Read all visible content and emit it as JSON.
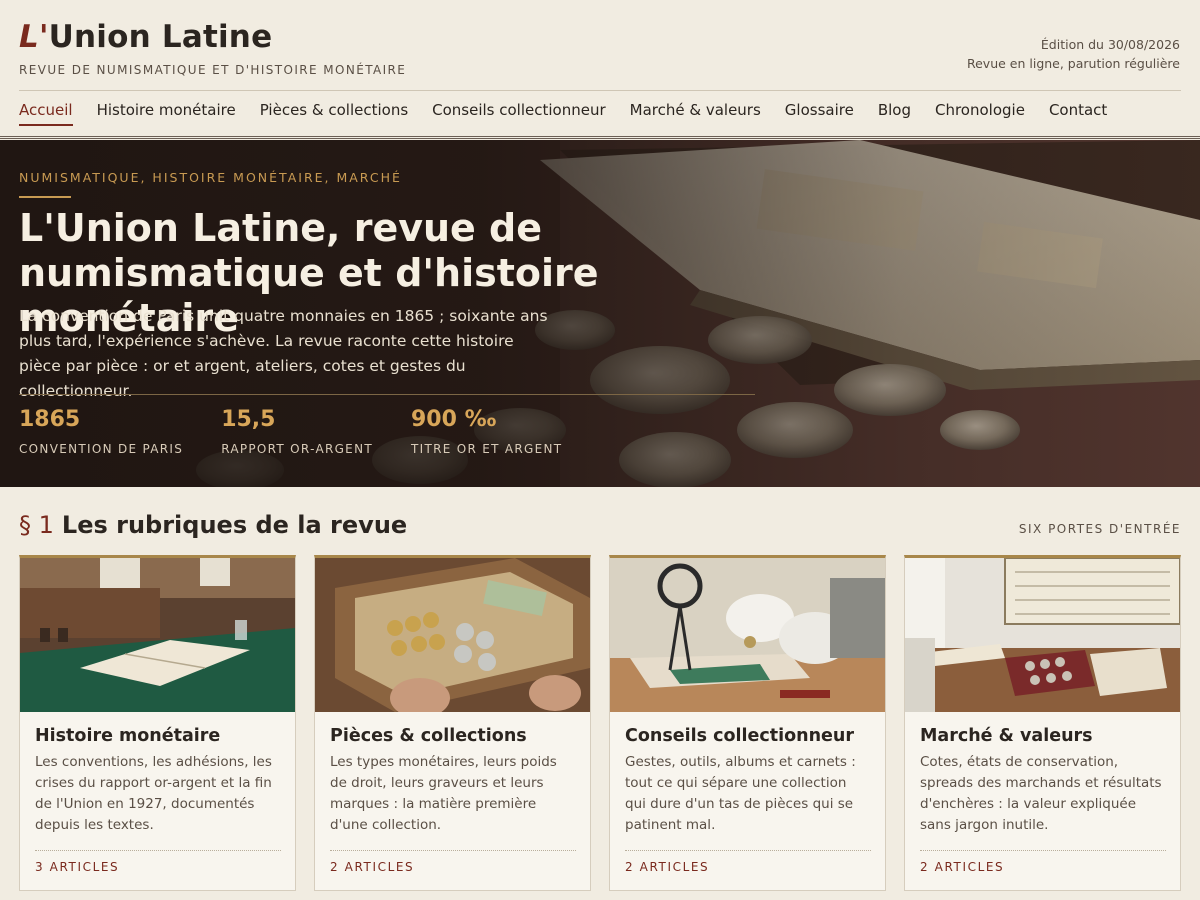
{
  "header": {
    "logo_mark": "L'",
    "logo_text": "Union Latine",
    "tagline": "REVUE DE NUMISMATIQUE ET D'HISTOIRE MONÉTAIRE",
    "edition": "Édition du 30/08/2026",
    "edition_note": "Revue en ligne, parution régulière"
  },
  "nav": {
    "items": [
      {
        "label": "Accueil",
        "active": true
      },
      {
        "label": "Histoire monétaire"
      },
      {
        "label": "Pièces & collections"
      },
      {
        "label": "Conseils collectionneur"
      },
      {
        "label": "Marché & valeurs"
      },
      {
        "label": "Glossaire"
      },
      {
        "label": "Blog"
      },
      {
        "label": "Chronologie"
      },
      {
        "label": "Contact"
      }
    ]
  },
  "hero": {
    "kicker": "NUMISMATIQUE, HISTOIRE MONÉTAIRE, MARCHÉ",
    "title": "L'Union Latine, revue de numismatique et d'histoire monétaire",
    "lede": "La convention de Paris unit quatre monnaies en 1865 ; soixante ans plus tard, l'expérience s'achève. La revue raconte cette histoire pièce par pièce : or et argent, ateliers, cotes et gestes du collectionneur.",
    "stats": [
      {
        "value": "1865",
        "label": "CONVENTION DE PARIS"
      },
      {
        "value": "15,5",
        "label": "RAPPORT OR-ARGENT"
      },
      {
        "value": "900 ‰",
        "label": "TITRE OR ET ARGENT"
      }
    ]
  },
  "section": {
    "number": "§ 1",
    "title": "Les rubriques de la revue",
    "aside": "SIX PORTES D'ENTRÉE"
  },
  "cards": [
    {
      "title": "Histoire monétaire",
      "text": "Les conventions, les adhésions, les crises du rapport or-argent et la fin de l'Union en 1927, documentés depuis les textes.",
      "count": "3 ARTICLES",
      "image": "reading-room-photo"
    },
    {
      "title": "Pièces & collections",
      "text": "Les types monétaires, leurs poids de droit, leurs graveurs et leurs marques : la matière première d'une collection.",
      "count": "2 ARTICLES",
      "image": "coin-drawer-photo"
    },
    {
      "title": "Conseils collectionneur",
      "text": "Gestes, outils, albums et carnets : tout ce qui sépare une collection qui dure d'un tas de pièces qui se patinent mal.",
      "count": "2 ARTICLES",
      "image": "gloved-hands-photo"
    },
    {
      "title": "Marché & valeurs",
      "text": "Cotes, états de conservation, spreads des marchands et résultats d'enchères : la valeur expliquée sans jargon inutile.",
      "count": "2 ARTICLES",
      "image": "auction-table-photo"
    }
  ],
  "colors": {
    "accent": "#7a2a1e",
    "gold": "#c89a52",
    "background": "#f1ece1",
    "hero_dark": "#2a1d17"
  }
}
